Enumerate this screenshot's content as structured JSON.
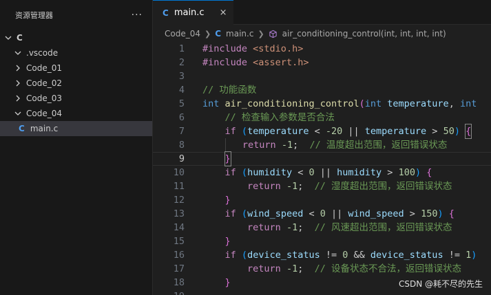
{
  "sidebar": {
    "title": "资源管理器",
    "more": "···",
    "root": "C",
    "items": [
      {
        "label": ".vscode",
        "state": "expanded"
      },
      {
        "label": "Code_01",
        "state": "collapsed"
      },
      {
        "label": "Code_02",
        "state": "collapsed"
      },
      {
        "label": "Code_03",
        "state": "collapsed"
      },
      {
        "label": "Code_04",
        "state": "expanded"
      }
    ],
    "file": {
      "icon": "C",
      "label": "main.c"
    }
  },
  "tab": {
    "icon": "C",
    "label": "main.c",
    "close": "×"
  },
  "breadcrumb": {
    "folder": "Code_04",
    "file_icon": "C",
    "file": "main.c",
    "symbol": "air_conditioning_control(int, int, int, int)"
  },
  "code": {
    "line_numbers": [
      "1",
      "2",
      "3",
      "4",
      "5",
      "6",
      "7",
      "8",
      "9",
      "10",
      "11",
      "12",
      "13",
      "14",
      "15",
      "16",
      "17",
      "18",
      "19"
    ],
    "current_line": "9",
    "l1": {
      "directive": "#include",
      "header": "<stdio.h>"
    },
    "l2": {
      "directive": "#include",
      "header": "<assert.h>"
    },
    "l4": {
      "comment": "// 功能函数"
    },
    "l5": {
      "type": "int",
      "name": "air_conditioning_control",
      "open": "(",
      "t1": "int",
      "p1": "temperature",
      "comma": ",",
      "t2": "int"
    },
    "l6": {
      "comment": "// 检查输入参数是否合法"
    },
    "l7": {
      "kw": "if",
      "open": "(",
      "v1": "temperature",
      "op1": " < ",
      "n1": "-20",
      "or": " || ",
      "v2": "temperature",
      "op2": " > ",
      "n2": "50",
      "close": ")",
      "brace": "{"
    },
    "l8": {
      "kw": "return",
      "val": "-1",
      "semi": ";",
      "comment": "// 温度超出范围，返回错误状态"
    },
    "l9": {
      "brace": "}"
    },
    "l10": {
      "kw": "if",
      "open": "(",
      "v1": "humidity",
      "op1": " < ",
      "n1": "0",
      "or": " || ",
      "v2": "humidity",
      "op2": " > ",
      "n2": "100",
      "close": ")",
      "brace": "{"
    },
    "l11": {
      "kw": "return",
      "val": "-1",
      "semi": ";",
      "comment": "// 湿度超出范围，返回错误状态"
    },
    "l12": {
      "brace": "}"
    },
    "l13": {
      "kw": "if",
      "open": "(",
      "v1": "wind_speed",
      "op1": " < ",
      "n1": "0",
      "or": " || ",
      "v2": "wind_speed",
      "op2": " > ",
      "n2": "150",
      "close": ")",
      "brace": "{"
    },
    "l14": {
      "kw": "return",
      "val": "-1",
      "semi": ";",
      "comment": "// 风速超出范围，返回错误状态"
    },
    "l15": {
      "brace": "}"
    },
    "l16": {
      "kw": "if",
      "open": "(",
      "v1": "device_status",
      "op1": " != ",
      "n1": "0",
      "and": " && ",
      "v2": "device_status",
      "op2": " != ",
      "n2": "1",
      "close": ")"
    },
    "l17": {
      "kw": "return",
      "val": "-1",
      "semi": ";",
      "comment": "// 设备状态不合法，返回错误状态"
    },
    "l18": {
      "brace": "}"
    }
  },
  "watermark": "CSDN @耗不尽的先生",
  "colors": {
    "accent": "#0078d4",
    "c_icon": "#4f9ded",
    "keyword": "#569cd6",
    "control": "#c586c0",
    "function": "#dcdcaa",
    "variable": "#9cdcfe",
    "number": "#b5cea8",
    "string": "#ce9178",
    "comment": "#6a9955"
  }
}
